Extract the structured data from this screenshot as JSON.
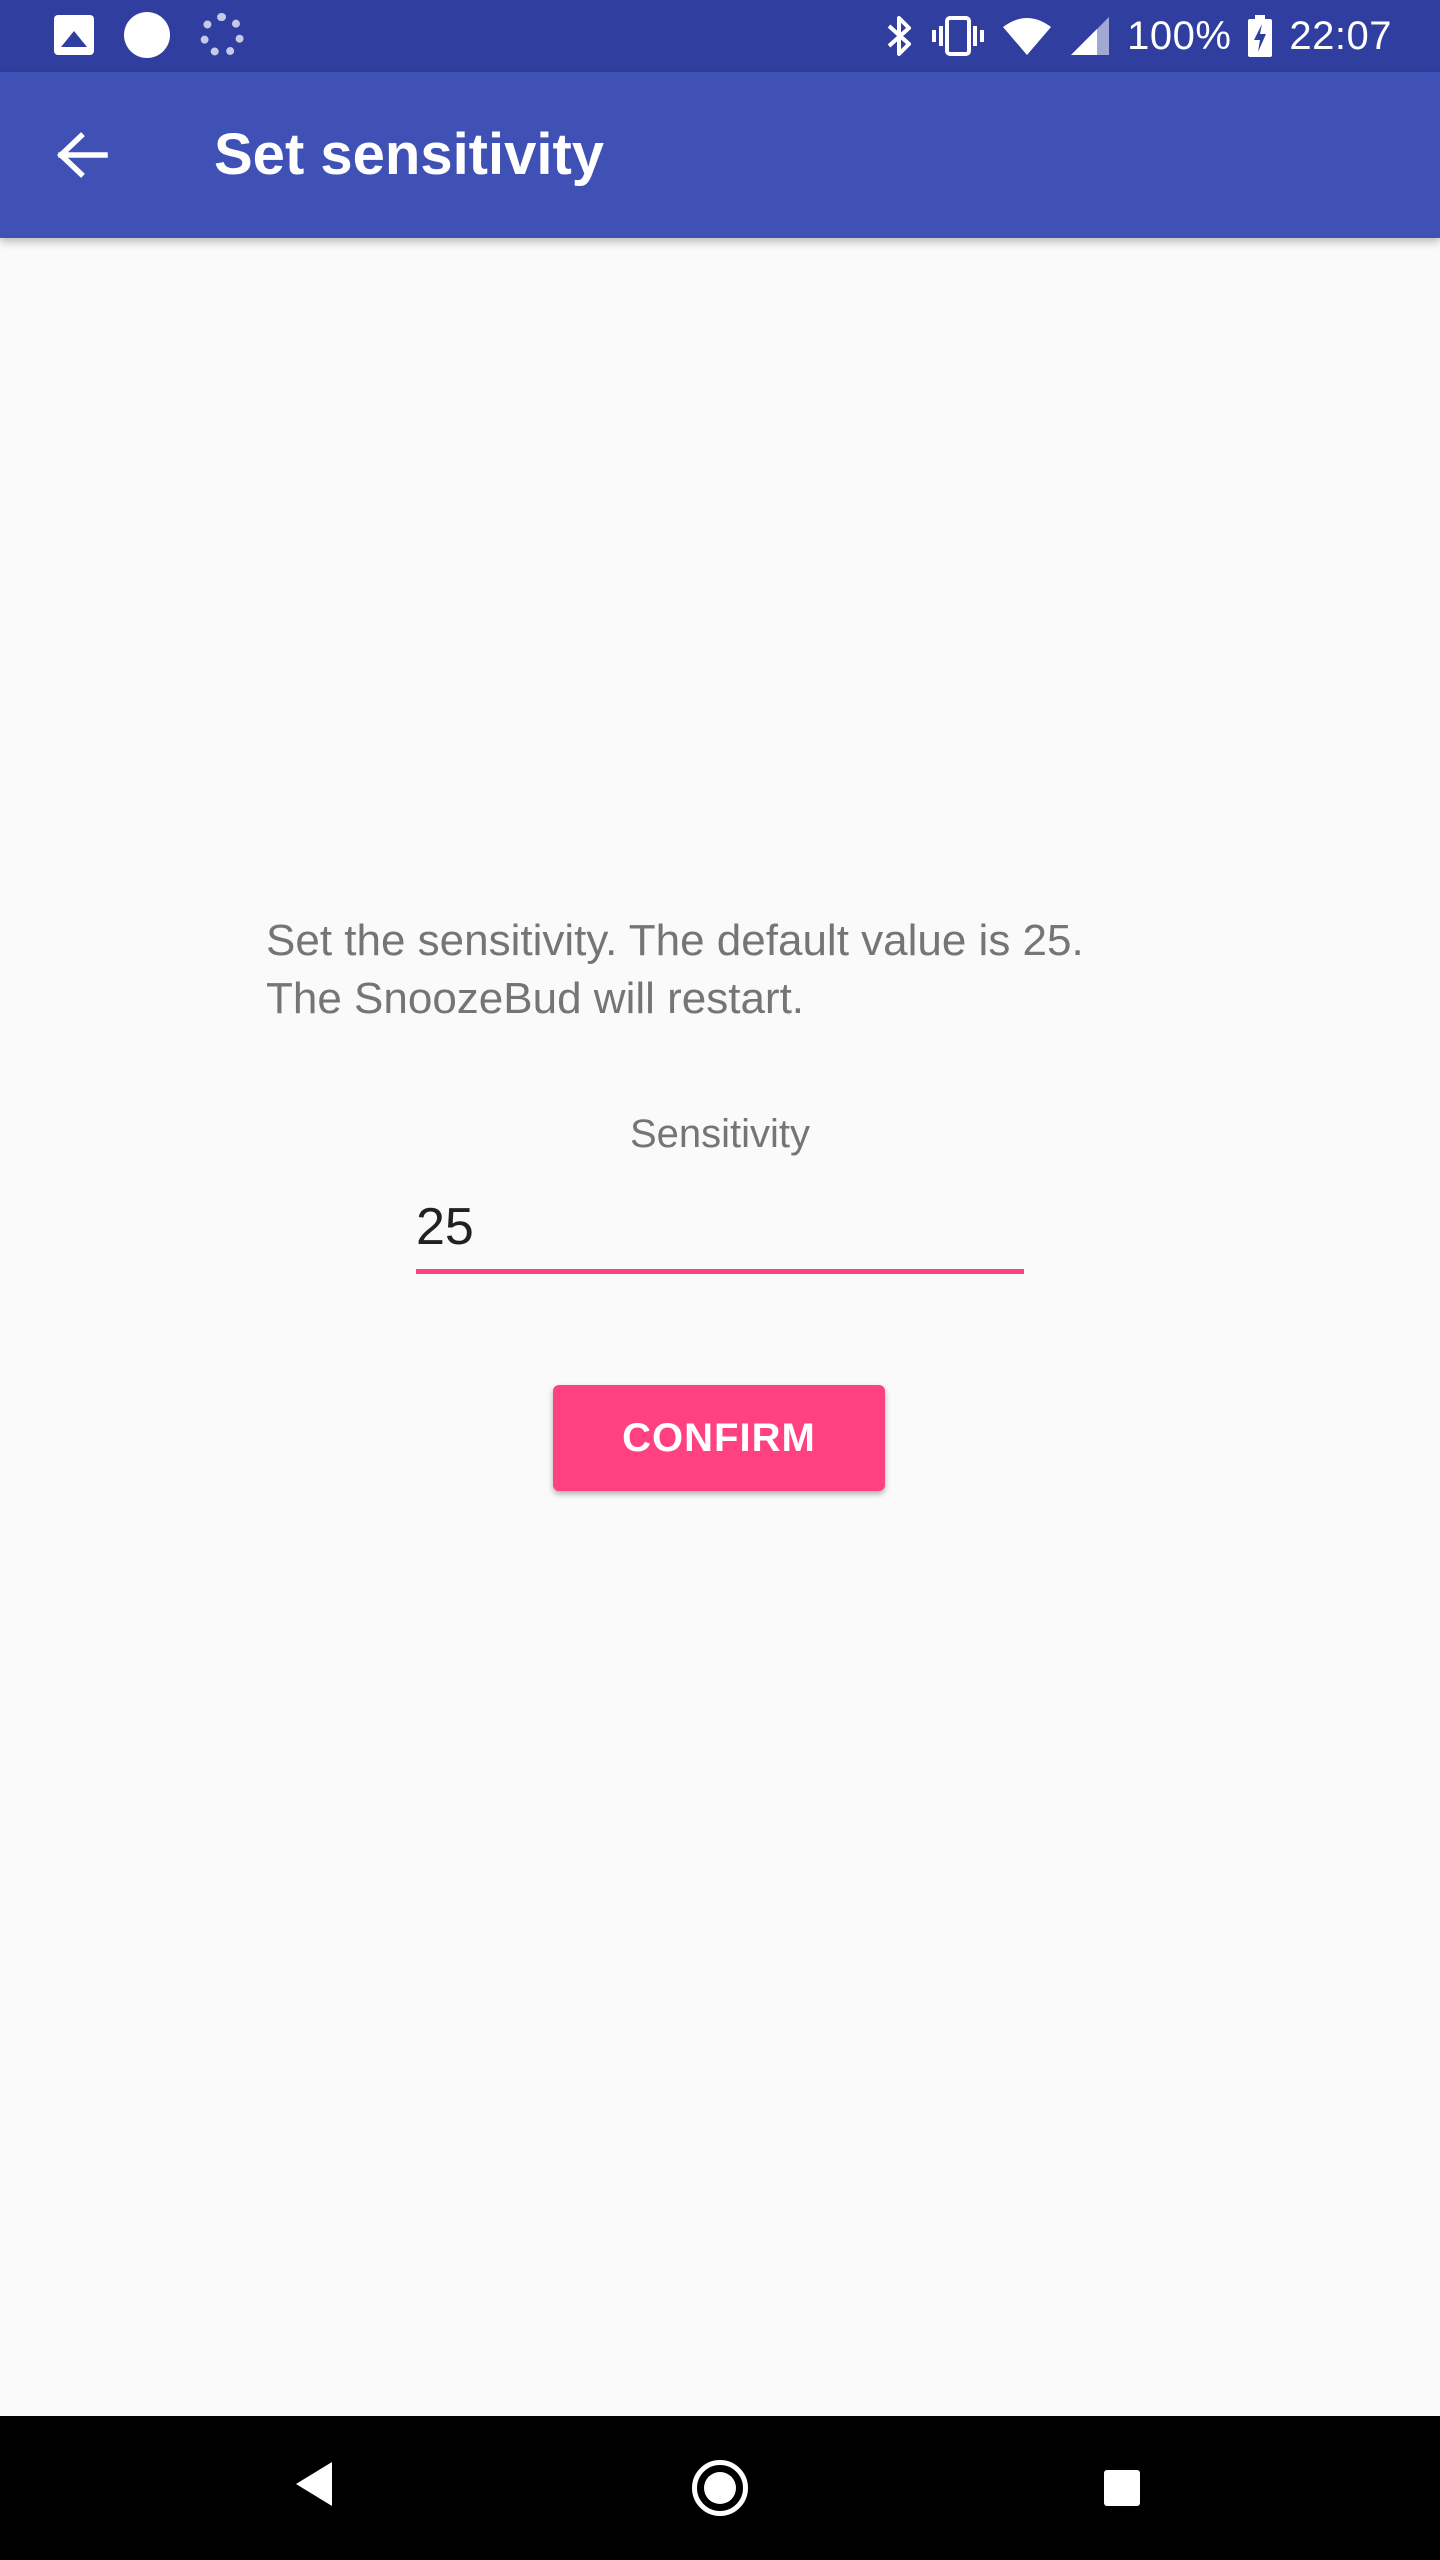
{
  "status_bar": {
    "icons": [
      "gallery-icon",
      "circle-notification-icon",
      "sync-spinner-icon",
      "bluetooth-icon",
      "vibrate-icon",
      "wifi-icon",
      "cell-signal-icon",
      "battery-charging-icon"
    ],
    "battery": "100%",
    "time": "22:07"
  },
  "app_bar": {
    "title": "Set sensitivity",
    "back_icon": "arrow-back-icon",
    "background_color": "#3f51b5"
  },
  "content": {
    "instructions_line1": "Set the sensitivity. The default value is 25.",
    "instructions_line2": "The SnoozeBud will restart.",
    "field_label": "Sensitivity",
    "field_value": "25",
    "confirm_label": "CONFIRM",
    "accent_color": "#ff4081"
  },
  "nav_bar": {
    "icons": [
      "nav-back-icon",
      "nav-home-icon",
      "nav-recents-icon"
    ]
  }
}
